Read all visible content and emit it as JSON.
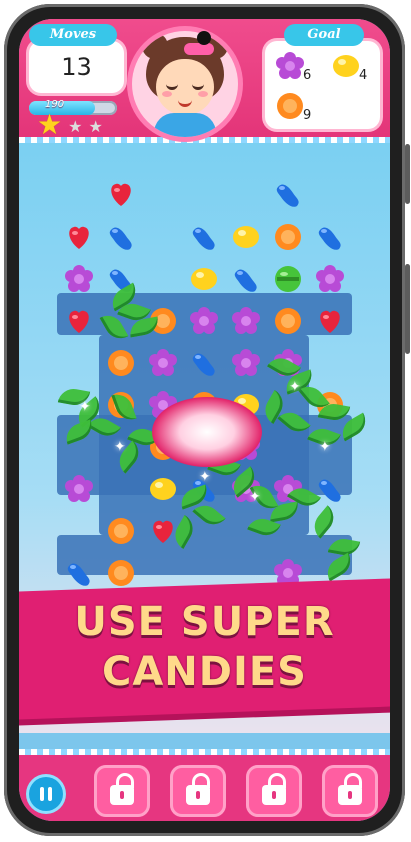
{
  "header": {
    "moves_label": "Moves",
    "moves_value": "13",
    "goal_label": "Goal",
    "score_value": "190",
    "score_progress": 0.75,
    "stars_earned": 1,
    "stars_total": 3
  },
  "goals": [
    {
      "candy": "purple-flower-candy",
      "count": "6"
    },
    {
      "candy": "yellow-lemon-candy",
      "count": "4"
    },
    {
      "candy": "orange-round-candy",
      "count": "9"
    }
  ],
  "banner": {
    "line1": "USE SUPER",
    "line2": "CANDIES"
  },
  "bottom_bar": {
    "pause_icon": "pause-icon",
    "boosters": [
      {
        "state": "locked",
        "icon": "lock-icon"
      },
      {
        "state": "locked",
        "icon": "lock-icon"
      },
      {
        "state": "locked",
        "icon": "lock-icon"
      },
      {
        "state": "locked",
        "icon": "lock-icon"
      }
    ]
  },
  "colors": {
    "header_pink": "#e33478",
    "tag_blue": "#38c6e9",
    "banner_pink": "#e01f72",
    "banner_text": "#ffd98a",
    "board_blue": "#3a72b6"
  }
}
